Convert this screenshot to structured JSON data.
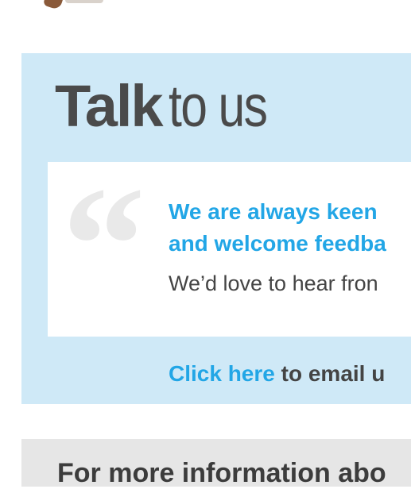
{
  "talk_panel": {
    "title_bold": "Talk",
    "title_light": "to us",
    "quote": {
      "line1": "We are always keen",
      "line2": "and welcome feedba",
      "subtext": "We’d love to hear fron"
    },
    "email": {
      "link_text": "Click here",
      "rest_text": " to email u"
    }
  },
  "info_panel": {
    "text": "For more information abo"
  },
  "colors": {
    "panel_bg": "#cfe9f7",
    "accent_blue": "#22a6e6",
    "title_gray": "#4a4a4a",
    "info_bg": "#e6e6e6"
  }
}
